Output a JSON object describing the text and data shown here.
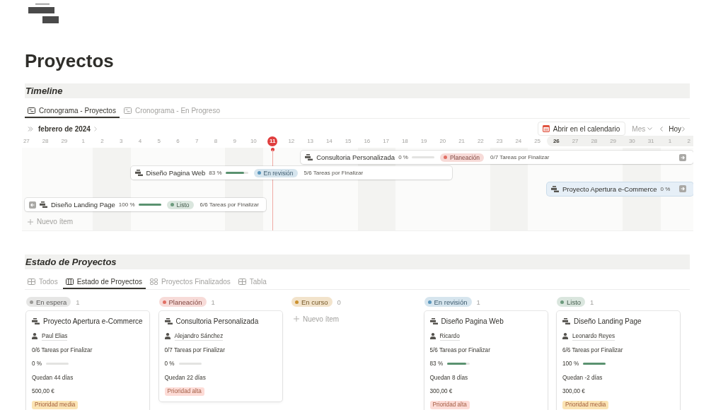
{
  "page": {
    "title": "Proyectos"
  },
  "timeline": {
    "heading": "Timeline",
    "tabs": [
      {
        "label": "Cronograma - Proyectos",
        "selected": true
      },
      {
        "label": "Cronograma - En Progreso",
        "selected": false
      }
    ],
    "month": "febrero de 2024",
    "calendar_button": "Abrir en el calendario",
    "scale": "Mes",
    "today_button": "Hoy",
    "days": [
      {
        "label": "27",
        "weekend": false,
        "today": false
      },
      {
        "label": "28",
        "weekend": false,
        "today": false
      },
      {
        "label": "29",
        "weekend": false,
        "today": false
      },
      {
        "label": "1",
        "weekend": false,
        "today": false
      },
      {
        "label": "2",
        "weekend": true,
        "today": false
      },
      {
        "label": "3",
        "weekend": true,
        "today": false
      },
      {
        "label": "4",
        "weekend": false,
        "today": false
      },
      {
        "label": "5",
        "weekend": false,
        "today": false
      },
      {
        "label": "6",
        "weekend": false,
        "today": false
      },
      {
        "label": "7",
        "weekend": false,
        "today": false
      },
      {
        "label": "8",
        "weekend": false,
        "today": false
      },
      {
        "label": "9",
        "weekend": true,
        "today": false
      },
      {
        "label": "10",
        "weekend": true,
        "today": false
      },
      {
        "label": "11",
        "weekend": false,
        "today": true
      },
      {
        "label": "12",
        "weekend": false,
        "today": false
      },
      {
        "label": "13",
        "weekend": false,
        "today": false
      },
      {
        "label": "14",
        "weekend": false,
        "today": false
      },
      {
        "label": "15",
        "weekend": false,
        "today": false
      },
      {
        "label": "16",
        "weekend": true,
        "today": false
      },
      {
        "label": "17",
        "weekend": true,
        "today": false
      },
      {
        "label": "18",
        "weekend": false,
        "today": false
      },
      {
        "label": "19",
        "weekend": false,
        "today": false
      },
      {
        "label": "20",
        "weekend": false,
        "today": false
      },
      {
        "label": "21",
        "weekend": false,
        "today": false
      },
      {
        "label": "22",
        "weekend": false,
        "today": false
      },
      {
        "label": "23",
        "weekend": true,
        "today": false
      },
      {
        "label": "24",
        "weekend": true,
        "today": false
      },
      {
        "label": "25",
        "weekend": false,
        "today": false
      },
      {
        "label": "26",
        "weekend": false,
        "today": false
      },
      {
        "label": "27",
        "weekend": false,
        "today": false
      },
      {
        "label": "28",
        "weekend": false,
        "today": false
      },
      {
        "label": "29",
        "weekend": false,
        "today": false
      },
      {
        "label": "30",
        "weekend": true,
        "today": false
      },
      {
        "label": "31",
        "weekend": true,
        "today": false
      },
      {
        "label": "1",
        "weekend": false,
        "today": false
      },
      {
        "label": "2",
        "weekend": false,
        "today": false
      }
    ],
    "bars": [
      {
        "name": "Consultoria Personalizada",
        "percent": "0 %",
        "level": 0,
        "status": {
          "label": "Planeación",
          "color": "#e16f64"
        },
        "tasks": "0/7 Tareas por Finalizar",
        "selected": false
      },
      {
        "name": "Diseño Pagina Web",
        "percent": "83 %",
        "level": 0.83,
        "status": {
          "label": "En revisión",
          "color": "#5b97bd"
        },
        "tasks": "5/6 Tareas por Finalizar",
        "selected": false
      },
      {
        "name": "Proyecto Apertura e-Commerce",
        "percent": "0 %",
        "selected": true
      },
      {
        "name": "Diseño Landing Page",
        "percent": "100 %",
        "level": 1,
        "status": {
          "label": "Listo",
          "color": "#6c9b7d"
        },
        "tasks": "6/6 Tareas por Finalizar",
        "selected": false
      }
    ],
    "new_item": "Nuevo ítem"
  },
  "board": {
    "heading": "Estado de Proyectos",
    "tabs": [
      {
        "label": "Todos",
        "kind": "table",
        "selected": false
      },
      {
        "label": "Estado de Proyectos",
        "kind": "board",
        "selected": true
      },
      {
        "label": "Proyectos Finalizados",
        "kind": "gallery",
        "selected": false
      },
      {
        "label": "Tabla",
        "kind": "table",
        "selected": false
      }
    ],
    "columns": [
      {
        "status": "En espera",
        "color": "#9b9a97",
        "count": "1",
        "cards": [
          {
            "title": "Proyecto Apertura e-Commerce",
            "owner": "Paul Elias",
            "tasks": "0/6 Tareas por Finalizar",
            "percent": "0 %",
            "level": 0,
            "remaining": "Quedan 44 días",
            "price": "500,00 €",
            "priority": {
              "label": "Prioridad media",
              "color": "#fbe4b4"
            }
          }
        ]
      },
      {
        "status": "Planeación",
        "color": "#e16f64",
        "count": "1",
        "cards": [
          {
            "title": "Consultoria Personalizada",
            "owner": "Alejandro Sánchez",
            "tasks": "0/7 Tareas por Finalizar",
            "percent": "0 %",
            "level": 0,
            "remaining": "Quedan 22 días",
            "priority": {
              "label": "Prioridad alta",
              "color": "#fddcd7"
            }
          }
        ]
      },
      {
        "status": "En curso",
        "color": "#cb912f",
        "count": "0",
        "new_item": "Nuevo ítem"
      },
      {
        "status": "En revisión",
        "color": "#5b97bd",
        "count": "1",
        "cards": [
          {
            "title": "Diseño Pagina Web",
            "owner": "Ricardo",
            "tasks": "5/6 Tareas por Finalizar",
            "percent": "83 %",
            "level": 0.83,
            "remaining": "Quedan 8 días",
            "price": "300,00 €",
            "priority": {
              "label": "Prioridad alta",
              "color": "#fddcd7"
            }
          }
        ]
      },
      {
        "status": "Listo",
        "color": "#6c9b7d",
        "count": "1",
        "cards": [
          {
            "title": "Diseño Landing Page",
            "owner": "Leonardo Reyes",
            "tasks": "6/6 Tareas por Finalizar",
            "percent": "100 %",
            "level": 1,
            "remaining": "Quedan -2 días",
            "price": "300,00 €",
            "priority": {
              "label": "Prioridad media",
              "color": "#fbe4b4"
            }
          }
        ]
      }
    ]
  }
}
